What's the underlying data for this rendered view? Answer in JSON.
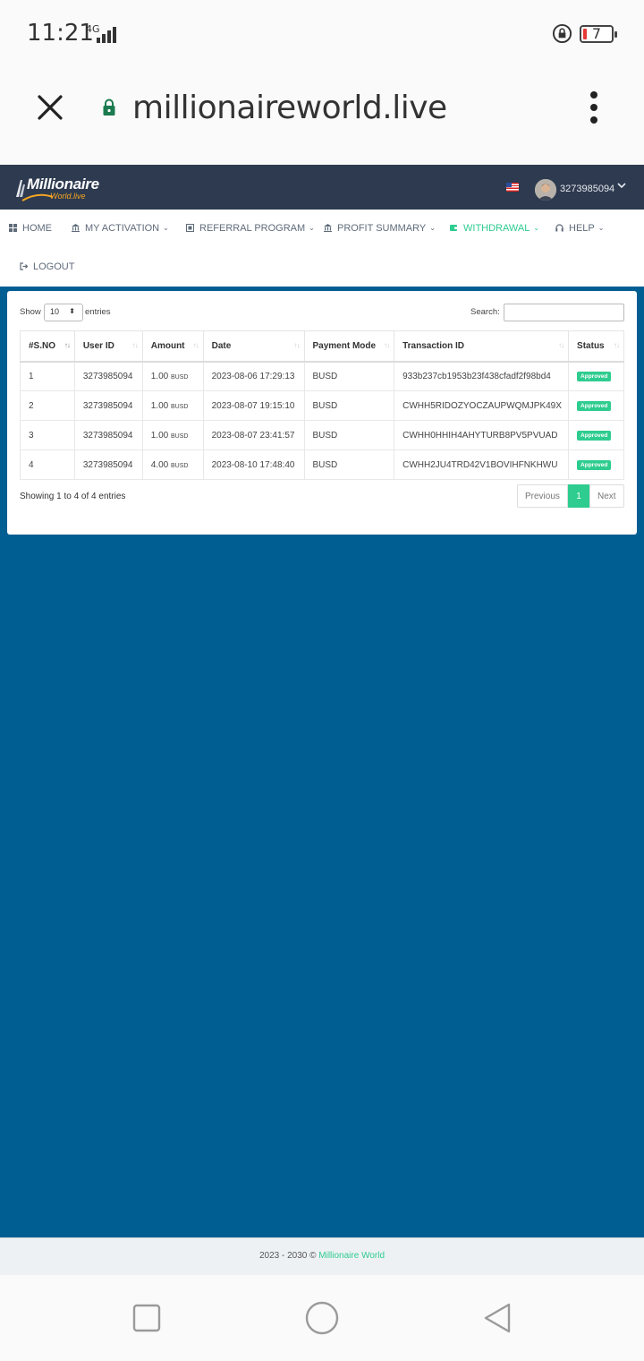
{
  "status_bar": {
    "time": "11:21",
    "network": "4G",
    "battery": "7"
  },
  "browser": {
    "url": "millionaireworld.live"
  },
  "header": {
    "logo_main": "Millionaire",
    "logo_sub": "World.live",
    "user_id": "3273985094"
  },
  "nav": {
    "items": [
      {
        "label": "HOME",
        "icon": "dashboard-icon",
        "caret": false
      },
      {
        "label": "MY ACTIVATION",
        "icon": "bank-icon",
        "caret": true
      },
      {
        "label": "REFERRAL PROGRAM",
        "icon": "referral-icon",
        "caret": true
      },
      {
        "label": "PROFIT SUMMARY",
        "icon": "bank-icon",
        "caret": true
      },
      {
        "label": "WITHDRAWAL",
        "icon": "wallet-icon",
        "caret": true,
        "active": true
      },
      {
        "label": "HELP",
        "icon": "headset-icon",
        "caret": true
      },
      {
        "label": "LOGOUT",
        "icon": "logout-icon",
        "caret": false
      }
    ]
  },
  "table_controls": {
    "show_label": "Show",
    "page_size": "10",
    "entries_label": "entries",
    "search_label": "Search:"
  },
  "table": {
    "columns": [
      "#S.NO",
      "User ID",
      "Amount",
      "Date",
      "Payment Mode",
      "Transaction ID",
      "Status"
    ],
    "rows": [
      {
        "sno": "1",
        "user_id": "3273985094",
        "amount": "1.00",
        "unit": "BUSD",
        "date": "2023-08-06 17:29:13",
        "mode": "BUSD",
        "txid": "933b237cb1953b23f438cfadf2f98bd4",
        "status": "Approved"
      },
      {
        "sno": "2",
        "user_id": "3273985094",
        "amount": "1.00",
        "unit": "BUSD",
        "date": "2023-08-07 19:15:10",
        "mode": "BUSD",
        "txid": "CWHH5RIDOZYOCZAUPWQMJPK49X",
        "status": "Approved"
      },
      {
        "sno": "3",
        "user_id": "3273985094",
        "amount": "1.00",
        "unit": "BUSD",
        "date": "2023-08-07 23:41:57",
        "mode": "BUSD",
        "txid": "CWHH0HHIH4AHYTURB8PV5PVUAD",
        "status": "Approved"
      },
      {
        "sno": "4",
        "user_id": "3273985094",
        "amount": "4.00",
        "unit": "BUSD",
        "date": "2023-08-10 17:48:40",
        "mode": "BUSD",
        "txid": "CWHH2JU4TRD42V1BOVIHFNKHWU",
        "status": "Approved"
      }
    ]
  },
  "pagination": {
    "info": "Showing 1 to 4 of 4 entries",
    "previous": "Previous",
    "current": "1",
    "next": "Next"
  },
  "footer": {
    "text": "2023 - 2030 © ",
    "brand": "Millionaire World"
  },
  "colors": {
    "header_bg": "#2d3a4f",
    "main_bg": "#005e92",
    "accent": "#2ecc8f"
  }
}
